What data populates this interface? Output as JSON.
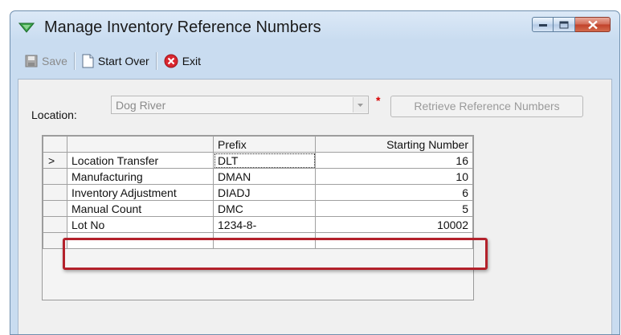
{
  "window": {
    "title": "Manage Inventory Reference Numbers",
    "icon": "green-triangle-icon"
  },
  "toolbar": {
    "save_label": "Save",
    "start_over_label": "Start Over",
    "exit_label": "Exit"
  },
  "location": {
    "label": "Location:",
    "value": "Dog River",
    "required_marker": "*",
    "retrieve_label": "Retrieve Reference Numbers"
  },
  "grid": {
    "columns": [
      "",
      "",
      "Prefix",
      "Starting Number"
    ],
    "rows": [
      {
        "indicator": ">",
        "name": "Location Transfer",
        "prefix": "DLT",
        "start": "16"
      },
      {
        "indicator": "",
        "name": "Manufacturing",
        "prefix": "DMAN",
        "start": "10"
      },
      {
        "indicator": "",
        "name": "Inventory Adjustment",
        "prefix": "DIADJ",
        "start": "6"
      },
      {
        "indicator": "",
        "name": "Manual Count",
        "prefix": "DMC",
        "start": "5"
      },
      {
        "indicator": "",
        "name": "Lot No",
        "prefix": "1234-8-",
        "start": "10002"
      }
    ]
  },
  "colors": {
    "highlight": "#b3212b",
    "exit_icon": "#d9262f",
    "required": "#d80000"
  }
}
